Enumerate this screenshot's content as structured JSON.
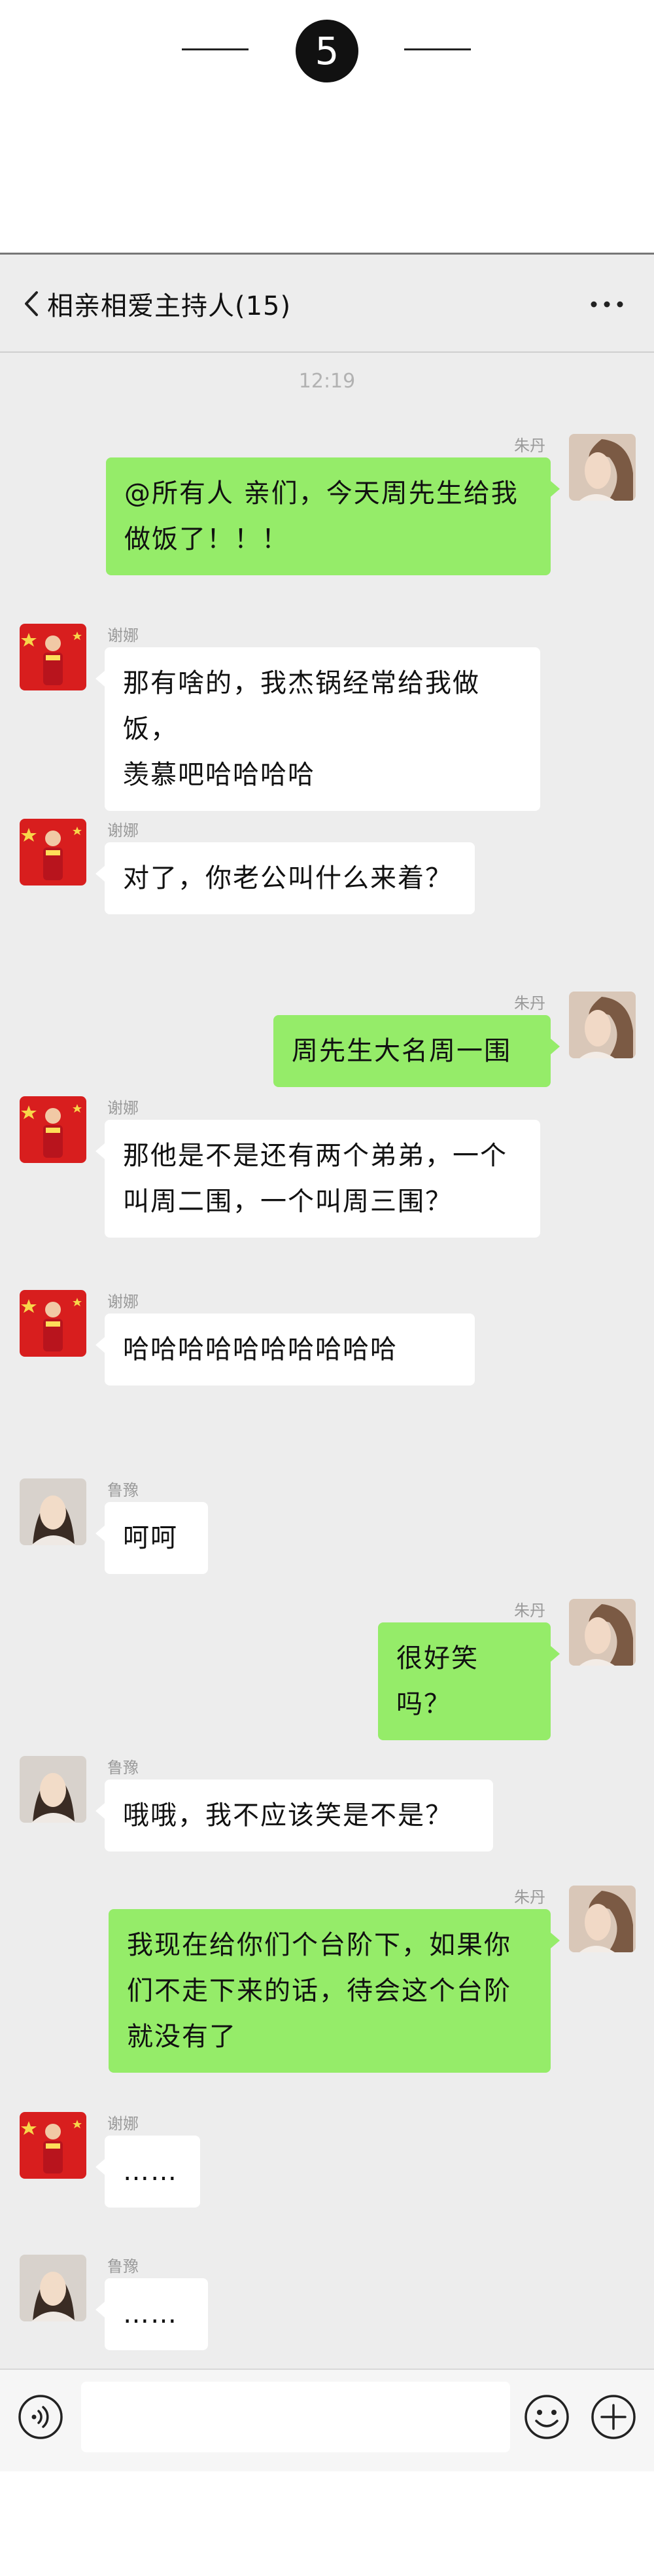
{
  "step": {
    "number": "5"
  },
  "header": {
    "title": "相亲相爱主持人(15)"
  },
  "chat": {
    "timestamp": "12:19",
    "messages": [
      {
        "sender": "朱丹",
        "text_lines": [
          "@所有人  亲们，今天周先生给我",
          "做饭了！！！"
        ],
        "direction": "outgoing",
        "avatar": "zhudan-avatar"
      },
      {
        "sender": "谢娜",
        "text_lines": [
          "那有啥的，我杰锅经常给我做饭，",
          "羡慕吧哈哈哈哈"
        ],
        "direction": "incoming",
        "avatar": "xiena-avatar"
      },
      {
        "sender": "谢娜",
        "text_lines": [
          "对了，你老公叫什么来着？"
        ],
        "direction": "incoming",
        "avatar": "xiena-avatar"
      },
      {
        "sender": "朱丹",
        "text_lines": [
          "周先生大名周一围"
        ],
        "direction": "outgoing",
        "avatar": "zhudan-avatar"
      },
      {
        "sender": "谢娜",
        "text_lines": [
          "那他是不是还有两个弟弟，一个",
          "叫周二围，一个叫周三围？"
        ],
        "direction": "incoming",
        "avatar": "xiena-avatar"
      },
      {
        "sender": "谢娜",
        "text_lines": [
          "哈哈哈哈哈哈哈哈哈哈"
        ],
        "direction": "incoming",
        "avatar": "xiena-avatar"
      },
      {
        "sender": "鲁豫",
        "text_lines": [
          "呵呵"
        ],
        "direction": "incoming",
        "avatar": "luyu-avatar"
      },
      {
        "sender": "朱丹",
        "text_lines": [
          "很好笑吗？"
        ],
        "direction": "outgoing",
        "avatar": "zhudan-avatar"
      },
      {
        "sender": "鲁豫",
        "text_lines": [
          "哦哦，我不应该笑是不是？"
        ],
        "direction": "incoming",
        "avatar": "luyu-avatar"
      },
      {
        "sender": "朱丹",
        "text_lines": [
          "我现在给你们个台阶下，如果你",
          "们不走下来的话，待会这个台阶",
          "就没有了"
        ],
        "direction": "outgoing",
        "avatar": "zhudan-avatar"
      },
      {
        "sender": "谢娜",
        "text_lines": [
          "……"
        ],
        "direction": "incoming",
        "avatar": "xiena-avatar"
      },
      {
        "sender": "鲁豫",
        "text_lines": [
          "……"
        ],
        "direction": "incoming",
        "avatar": "luyu-avatar"
      }
    ]
  },
  "inputbar": {
    "placeholder": ""
  },
  "icons": {
    "back": "back-arrow-icon",
    "more": "more-dots-icon",
    "voice": "voice-icon",
    "emoji": "emoji-icon",
    "plus": "plus-icon"
  },
  "colors": {
    "outgoing_bubble": "#95ec69",
    "incoming_bubble": "#ffffff",
    "chat_background": "#ededed"
  }
}
